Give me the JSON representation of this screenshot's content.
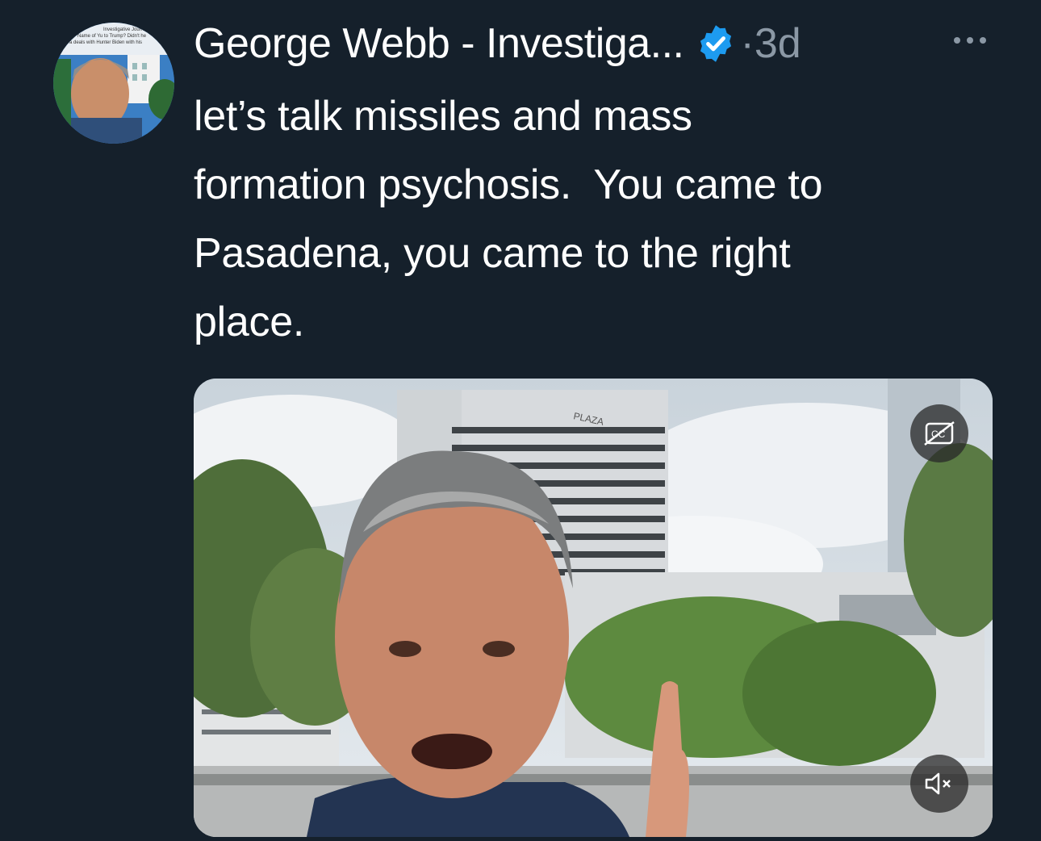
{
  "tweet": {
    "author_name": "George Webb - Investiga...",
    "separator": "·",
    "timestamp": "3d",
    "text": "let’s talk missiles and mass\nformation psychosis.  You came to\nPasadena, you came to the right\nplace.",
    "avatar_caption_lines": [
      "Investigative Journalist",
      "Name of Yu to Trump? Didn't he",
      "a deals with Hunter Biden with his"
    ]
  },
  "video": {
    "building_sign": "PLAZA"
  },
  "icons": {
    "verified": "verified-badge-icon",
    "more": "more-options-icon",
    "captions": "captions-off-icon",
    "mute": "muted-speaker-icon"
  },
  "colors": {
    "background": "#15202b",
    "verified_blue": "#1d9bf0",
    "secondary_text": "#8b98a5"
  }
}
